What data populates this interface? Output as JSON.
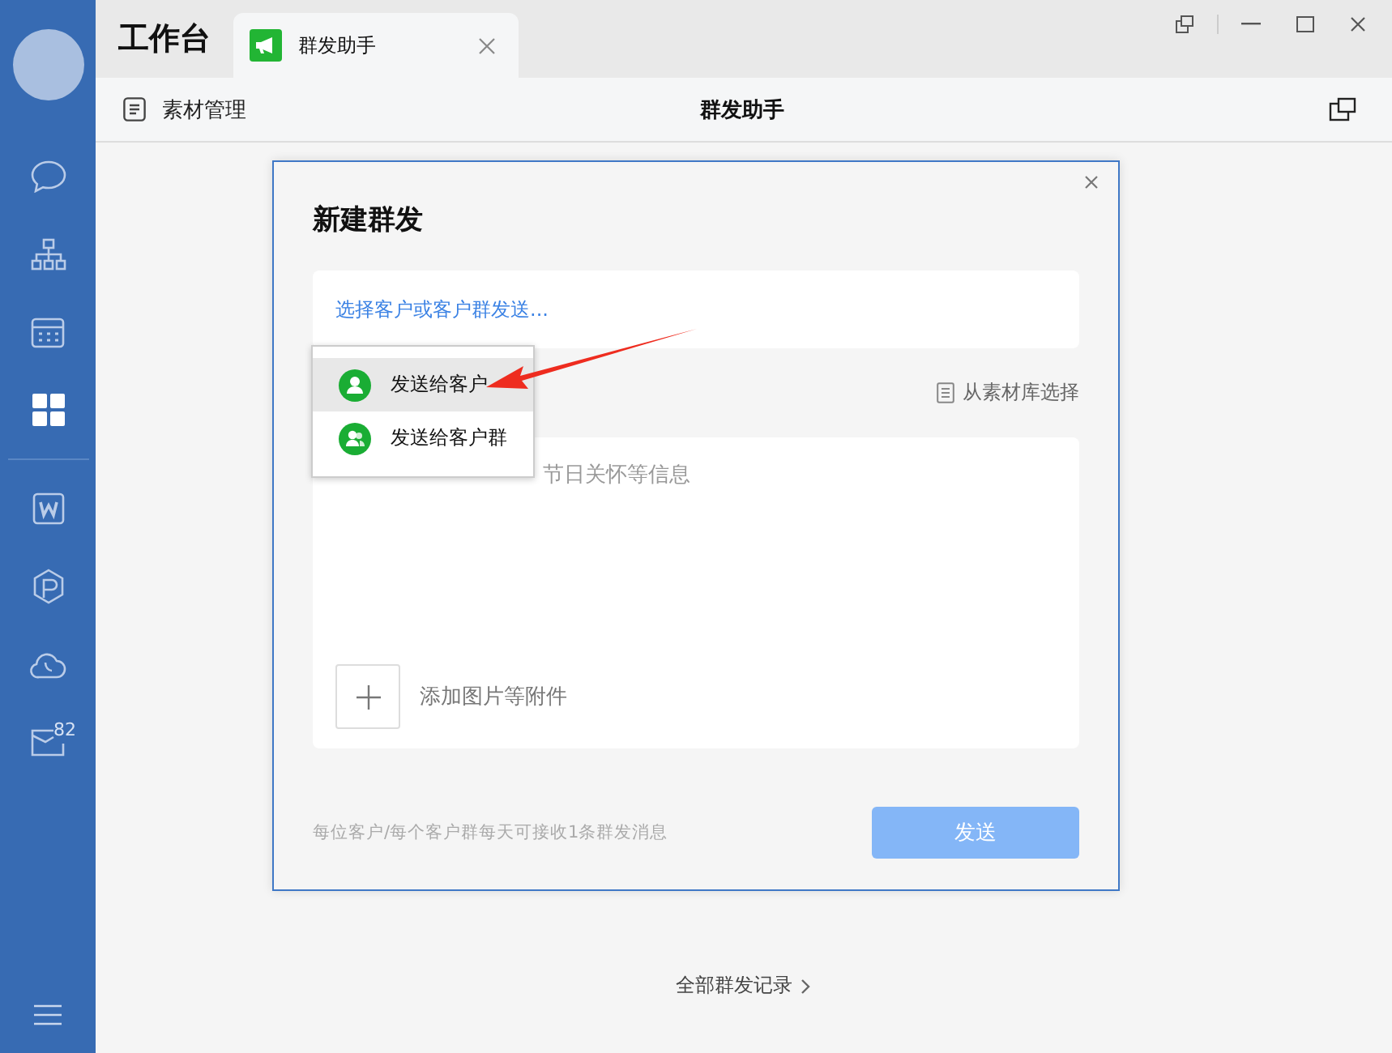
{
  "sidebar": {
    "items": [
      {
        "kind": "chat",
        "selected": false
      },
      {
        "kind": "org",
        "selected": false
      },
      {
        "kind": "calendar",
        "selected": false
      },
      {
        "kind": "grid",
        "selected": true
      },
      {
        "kind": "divider"
      },
      {
        "kind": "doc",
        "selected": false
      },
      {
        "kind": "hex",
        "selected": false
      },
      {
        "kind": "cloud",
        "selected": false
      },
      {
        "kind": "mail",
        "selected": false,
        "badge": "82"
      }
    ]
  },
  "header": {
    "title": "工作台",
    "tabs": [
      {
        "label": "群发助手",
        "selected": true
      }
    ]
  },
  "toolbar": {
    "left": "素材管理",
    "title": "群发助手"
  },
  "dialog": {
    "title": "新建群发",
    "recipient_placeholder": "选择客户或客户群发送...",
    "library_link": "从素材库选择",
    "message_placeholder": "节日关怀等信息",
    "attach_label": "添加图片等附件",
    "footer_note": "每位客户/每个客户群每天可接收1条群发消息",
    "send_button": {
      "label": "发送",
      "disabled": true
    }
  },
  "dropdown": {
    "items": [
      {
        "label": "发送给客户",
        "kind": "customer",
        "selected": true
      },
      {
        "label": "发送给客户群",
        "kind": "group",
        "selected": false
      }
    ]
  },
  "history_link": "全部群发记录"
}
